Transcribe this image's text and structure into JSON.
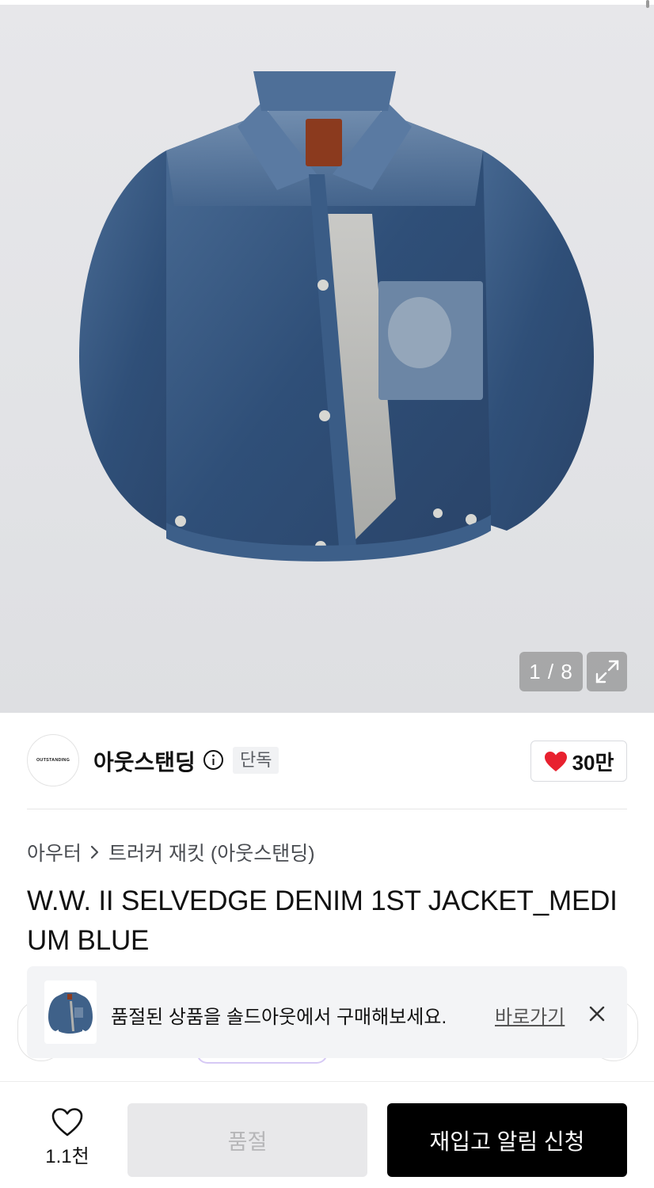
{
  "gallery": {
    "counter": "1 / 8",
    "image": "denim-jacket-photo",
    "expand_icon": "expand-icon"
  },
  "brand": {
    "logo_text": "OUTSTANDING",
    "name": "아웃스탠딩",
    "info_icon": "info-icon",
    "badge": "단독",
    "like_icon": "heart-filled-icon",
    "like_count": "30만",
    "like_color": "#e8212f"
  },
  "breadcrumb": {
    "category": "아우터",
    "separator_icon": "chevron-right-icon",
    "subcategory": "트러커 재킷 (아웃스탠딩)"
  },
  "product": {
    "title": "W.W. II SELVEDGE DENIM 1ST JACKET_MEDIUM BLUE"
  },
  "toast": {
    "message": "품절된 상품을 솔드아웃에서 구매해보세요.",
    "link": "바로가기",
    "close_icon": "close-icon"
  },
  "bottom_bar": {
    "wish_icon": "heart-outline-icon",
    "wish_count": "1.1천",
    "soldout_label": "품절",
    "restock_label": "재입고 알림 신청"
  }
}
